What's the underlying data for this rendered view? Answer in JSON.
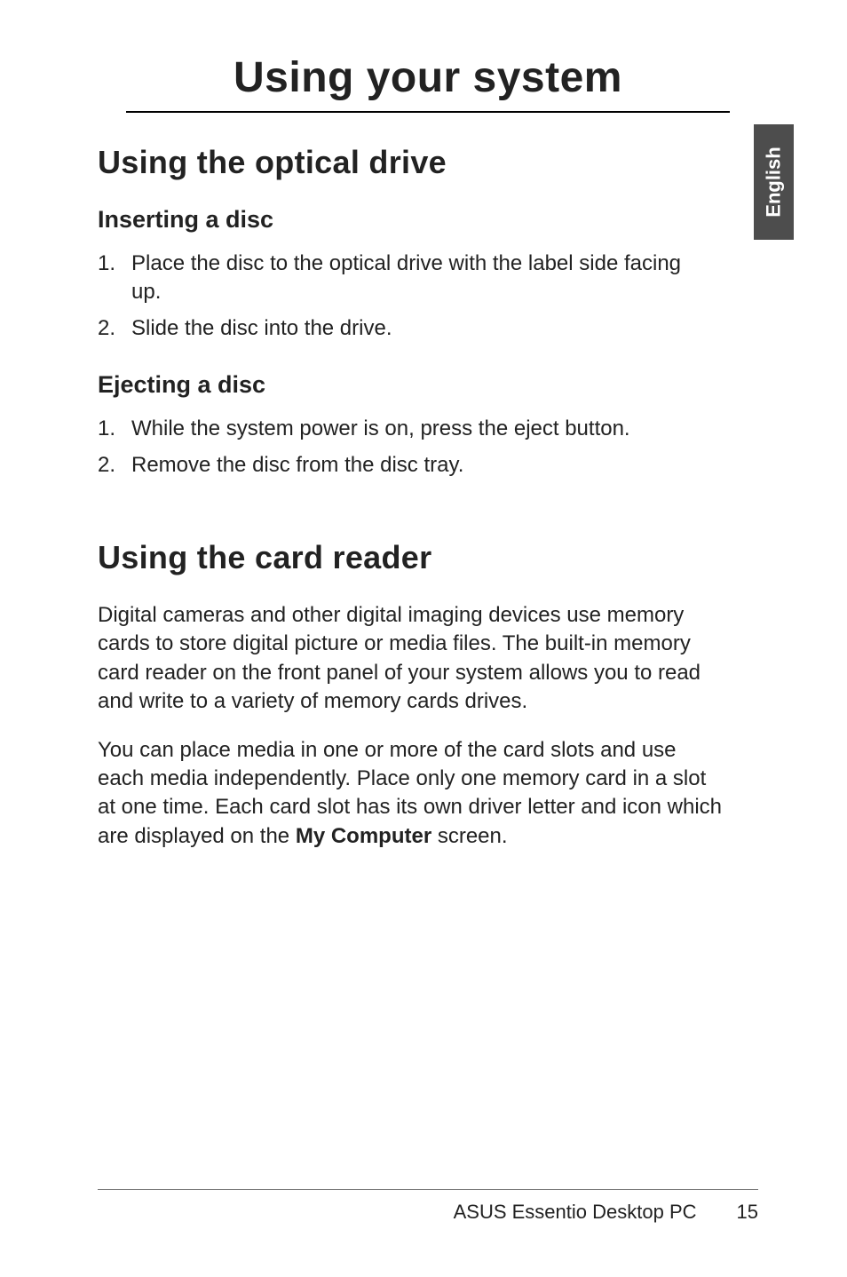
{
  "sideTab": {
    "label": "English"
  },
  "mainTitle": "Using your system",
  "section1": {
    "title": "Using the optical drive",
    "sub1": {
      "title": "Inserting a disc",
      "steps": [
        {
          "n": "1.",
          "text": "Place the disc to the optical drive with the label side facing up."
        },
        {
          "n": "2.",
          "text": "Slide the disc into the drive."
        }
      ]
    },
    "sub2": {
      "title": "Ejecting a disc",
      "steps": [
        {
          "n": "1.",
          "text": "While the system power is on, press the eject button."
        },
        {
          "n": "2.",
          "text": "Remove the disc from the disc tray."
        }
      ]
    }
  },
  "section2": {
    "title": "Using the card reader",
    "para1": "Digital cameras and other digital imaging devices use memory cards to store digital picture or media files. The built-in memory card reader on the front panel of your system allows you to read and write to a variety of memory cards drives.",
    "para2_pre": "You can place media in one or more of the card slots and use each media independently. Place only one memory card in a slot at one time. Each card slot has its own driver letter and icon which are displayed on the ",
    "para2_bold": "My Computer",
    "para2_post": " screen."
  },
  "footer": {
    "product": "ASUS Essentio Desktop PC",
    "page": "15"
  }
}
